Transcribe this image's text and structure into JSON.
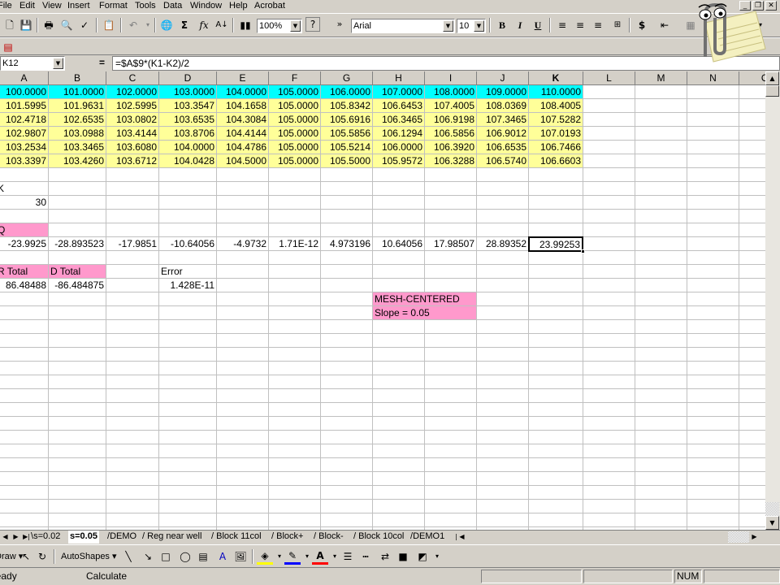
{
  "menu": {
    "items": [
      "File",
      "Edit",
      "View",
      "Insert",
      "Format",
      "Tools",
      "Data",
      "Window",
      "Help",
      "Acrobat"
    ]
  },
  "standard_toolbar": {
    "zoom": "100%",
    "help_icon": "question-icon"
  },
  "formatting_toolbar": {
    "font": "Arial",
    "font_size": "10",
    "bold": "B",
    "italic": "I",
    "underline": "U",
    "currency": "$"
  },
  "formula_bar": {
    "name_box": "K12",
    "equals": "=",
    "formula": "=$A$9*(K1-K2)/2"
  },
  "columns": [
    "A",
    "B",
    "C",
    "D",
    "E",
    "F",
    "G",
    "H",
    "I",
    "J",
    "K",
    "L",
    "M",
    "N",
    "O"
  ],
  "active_column": "K",
  "rows": {
    "row1": [
      "100.0000",
      "101.0000",
      "102.0000",
      "103.0000",
      "104.0000",
      "105.0000",
      "106.0000",
      "107.0000",
      "108.0000",
      "109.0000",
      "110.0000"
    ],
    "yellow": [
      [
        "101.5995",
        "101.9631",
        "102.5995",
        "103.3547",
        "104.1658",
        "105.0000",
        "105.8342",
        "106.6453",
        "107.4005",
        "108.0369",
        "108.4005"
      ],
      [
        "102.4718",
        "102.6535",
        "103.0802",
        "103.6535",
        "104.3084",
        "105.0000",
        "105.6916",
        "106.3465",
        "106.9198",
        "107.3465",
        "107.5282"
      ],
      [
        "102.9807",
        "103.0988",
        "103.4144",
        "103.8706",
        "104.4144",
        "105.0000",
        "105.5856",
        "106.1294",
        "106.5856",
        "106.9012",
        "107.0193"
      ],
      [
        "103.2534",
        "103.3465",
        "103.6080",
        "104.0000",
        "104.4786",
        "105.0000",
        "105.5214",
        "106.0000",
        "106.3920",
        "106.6535",
        "106.7466"
      ],
      [
        "103.3397",
        "103.4260",
        "103.6712",
        "104.0428",
        "104.5000",
        "105.0000",
        "105.5000",
        "105.9572",
        "106.3288",
        "106.5740",
        "106.6603"
      ]
    ],
    "k_label": "K",
    "k_value": "30",
    "q_label": "Q",
    "q_row": [
      "-23.9925",
      "-28.893523",
      "-17.9851",
      "-10.64056",
      "-4.9732",
      "1.71E-12",
      "4.973196",
      "10.64056",
      "17.98507",
      "28.89352",
      "23.99253"
    ],
    "r_total_label": "R Total",
    "d_total_label": "D Total",
    "error_label": "Error",
    "r_total_value": "86.48488",
    "d_total_value": "-86.484875",
    "error_value": "1.428E-11",
    "note_line1": "MESH-CENTERED",
    "note_line2": "Slope = 0.05"
  },
  "sheet_tabs": [
    "s=0.02",
    "s=0.05",
    "DEMO",
    "Reg near well",
    "Block 11col",
    "Block+",
    "Block-",
    "Block 10col",
    "DEMO1"
  ],
  "active_tab": "s=0.05",
  "draw_toolbar": {
    "draw": "Draw",
    "autoshapes": "AutoShapes"
  },
  "status_bar": {
    "ready": "Ready",
    "mode": "Calculate",
    "num": "NUM"
  },
  "colors": {
    "cyan": "#00ffff",
    "yellow": "#ffff99",
    "pink": "#ff99cc",
    "chrome": "#d4d0c8"
  }
}
